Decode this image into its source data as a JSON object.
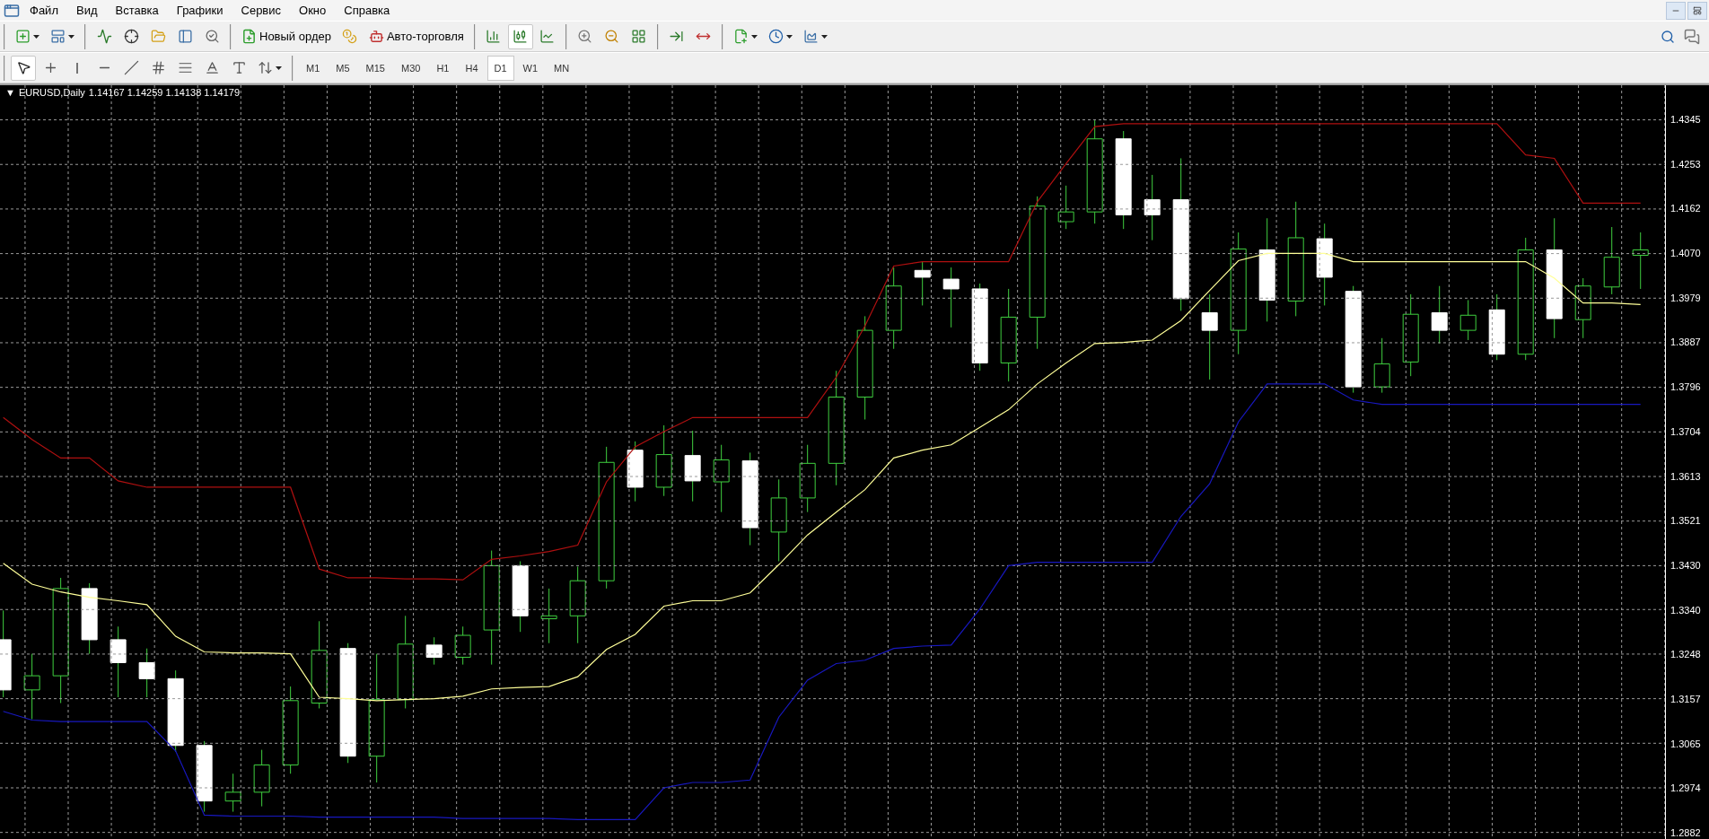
{
  "menu": {
    "items": [
      "Файл",
      "Вид",
      "Вставка",
      "Графики",
      "Сервис",
      "Окно",
      "Справка"
    ]
  },
  "toolbar": {
    "new_order": "Новый ордер",
    "autotrading": "Авто-торговля",
    "chart_types": [
      {
        "selected": false
      },
      {
        "selected": true
      },
      {
        "selected": false
      }
    ]
  },
  "drawing_toolbar": {
    "tools": [
      {
        "selected": true
      },
      {
        "selected": false
      },
      {
        "selected": false
      },
      {
        "selected": false
      },
      {
        "selected": false
      },
      {
        "selected": false
      },
      {
        "selected": false
      },
      {
        "selected": false
      },
      {
        "selected": false
      },
      {
        "selected": false
      }
    ],
    "periods": [
      {
        "label": "M1",
        "selected": false
      },
      {
        "label": "M5",
        "selected": false
      },
      {
        "label": "M15",
        "selected": false
      },
      {
        "label": "M30",
        "selected": false
      },
      {
        "label": "H1",
        "selected": false
      },
      {
        "label": "H4",
        "selected": false
      },
      {
        "label": "D1",
        "selected": true
      },
      {
        "label": "W1",
        "selected": false
      },
      {
        "label": "MN",
        "selected": false
      }
    ]
  },
  "chart": {
    "arrow": "▼",
    "title": "EURUSD,Daily",
    "ohlc": "1.14167 1.14259 1.14138 1.14179",
    "chart_data": {
      "type": "line",
      "grid": true,
      "ylim": [
        1.2869,
        1.4416
      ],
      "yticks": [
        {
          "value": 1.4345,
          "label": "1.4345"
        },
        {
          "value": 1.42535,
          "label": "1.4253"
        },
        {
          "value": 1.4162,
          "label": "1.4162"
        },
        {
          "value": 1.40705,
          "label": "1.4070"
        },
        {
          "value": 1.3979,
          "label": "1.3979"
        },
        {
          "value": 1.38875,
          "label": "1.3887"
        },
        {
          "value": 1.3796,
          "label": "1.3796"
        },
        {
          "value": 1.37045,
          "label": "1.3704"
        },
        {
          "value": 1.3613,
          "label": "1.3613"
        },
        {
          "value": 1.35215,
          "label": "1.3521"
        },
        {
          "value": 1.343,
          "label": "1.3430"
        },
        {
          "value": 1.334,
          "label": "1.3340"
        },
        {
          "value": 1.32485,
          "label": "1.3248"
        },
        {
          "value": 1.3157,
          "label": "1.3157"
        },
        {
          "value": 1.30655,
          "label": "1.3065"
        },
        {
          "value": 1.2974,
          "label": "1.2974"
        },
        {
          "value": 1.28825,
          "label": "1.2882"
        }
      ],
      "series": [
        {
          "color": "#b01010",
          "values": [
            1.3734,
            1.3689,
            1.3651,
            1.3651,
            1.3604,
            1.3591,
            1.3591,
            1.3591,
            1.3591,
            1.3591,
            1.3591,
            1.3423,
            1.3405,
            1.3405,
            1.3403,
            1.3403,
            1.3401,
            1.3443,
            1.345,
            1.3459,
            1.3472,
            1.3602,
            1.3674,
            1.3705,
            1.3734,
            1.3734,
            1.3734,
            1.3734,
            1.3734,
            1.3817,
            1.3922,
            1.4045,
            1.4054,
            1.4054,
            1.4054,
            1.4054,
            1.4177,
            1.4255,
            1.4331,
            1.4337,
            1.4337,
            1.4337,
            1.4337,
            1.4337,
            1.4337,
            1.4337,
            1.4337,
            1.4337,
            1.4337,
            1.4337,
            1.4337,
            1.4337,
            1.4337,
            1.4273,
            1.4266,
            1.4174,
            1.4174,
            1.4174
          ]
        },
        {
          "color": "#ffff99",
          "values": [
            1.3435,
            1.3392,
            1.3376,
            1.3365,
            1.3358,
            1.335,
            1.3285,
            1.3253,
            1.3251,
            1.3251,
            1.3249,
            1.316,
            1.3157,
            1.3153,
            1.3155,
            1.3157,
            1.3162,
            1.3177,
            1.318,
            1.3182,
            1.3202,
            1.3258,
            1.3289,
            1.3347,
            1.3358,
            1.3358,
            1.3374,
            1.3432,
            1.3493,
            1.354,
            1.3586,
            1.3651,
            1.3667,
            1.3678,
            1.3714,
            1.375,
            1.3803,
            1.3846,
            1.3886,
            1.3888,
            1.3893,
            1.3933,
            1.3995,
            1.4056,
            1.4071,
            1.4071,
            1.4071,
            1.4054,
            1.4054,
            1.4054,
            1.4054,
            1.4054,
            1.4054,
            1.4054,
            1.402,
            1.3969,
            1.3969,
            1.3966
          ]
        },
        {
          "color": "#1818c0",
          "values": [
            1.3131,
            1.3113,
            1.311,
            1.311,
            1.311,
            1.311,
            1.305,
            1.2918,
            1.2916,
            1.2916,
            1.2916,
            1.2914,
            1.2914,
            1.2914,
            1.2914,
            1.2914,
            1.2911,
            1.2911,
            1.2911,
            1.2911,
            1.2909,
            1.2909,
            1.2909,
            1.2974,
            1.2985,
            1.2985,
            1.299,
            1.3119,
            1.3195,
            1.3229,
            1.3236,
            1.326,
            1.3265,
            1.3267,
            1.3341,
            1.343,
            1.3437,
            1.3437,
            1.3437,
            1.3437,
            1.3437,
            1.3531,
            1.3598,
            1.3725,
            1.3803,
            1.3803,
            1.3803,
            1.377,
            1.3761,
            1.3761,
            1.3761,
            1.3761,
            1.3761,
            1.3761,
            1.3761,
            1.3761,
            1.3761,
            1.3761
          ]
        }
      ]
    }
  }
}
